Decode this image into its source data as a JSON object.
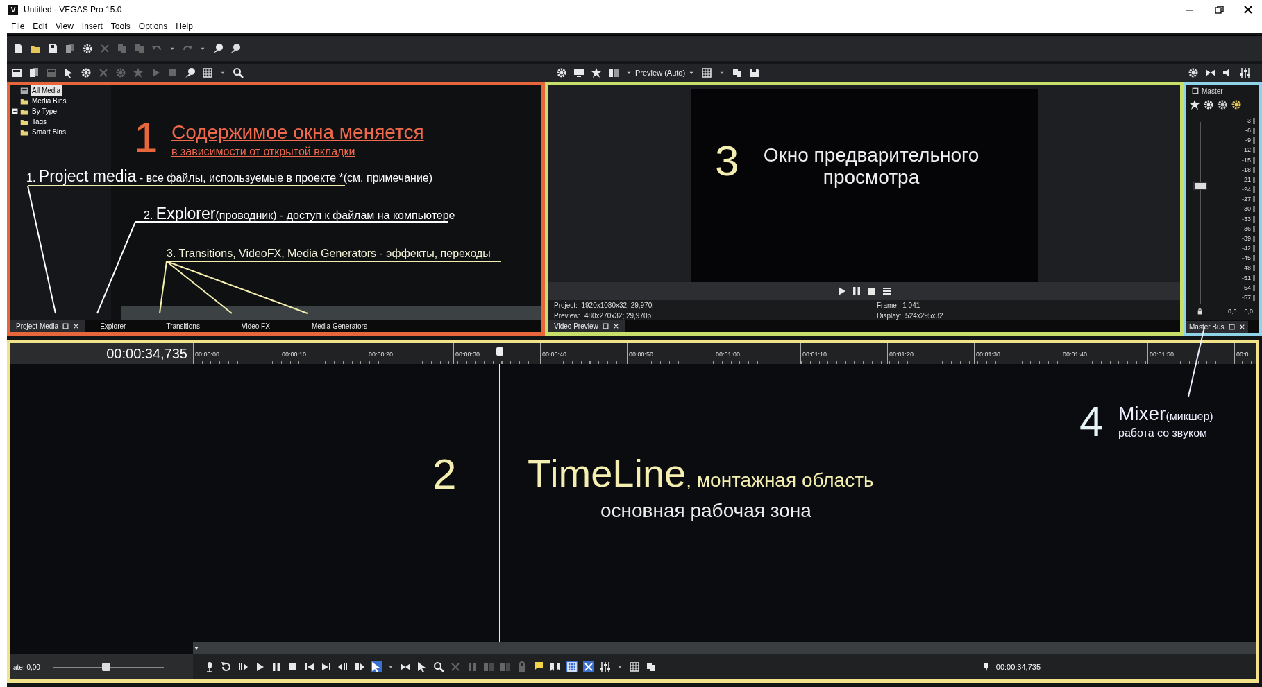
{
  "window": {
    "logo": "V",
    "title": "Untitled - VEGAS Pro 15.0"
  },
  "menu": [
    "File",
    "Edit",
    "View",
    "Insert",
    "Tools",
    "Options",
    "Help"
  ],
  "media_panel": {
    "tree": [
      {
        "label": "All Media",
        "selected": true
      },
      {
        "label": "Media Bins",
        "selected": false
      },
      {
        "label": "By Type",
        "selected": false,
        "expanded": true
      },
      {
        "label": "Tags",
        "selected": false
      },
      {
        "label": "Smart Bins",
        "selected": false
      }
    ],
    "annotation": {
      "number": "1",
      "title": "Содержимое окна меняется",
      "subtitle": "в зависимости от открытой вкладки"
    },
    "notes": [
      {
        "number": "1.",
        "term": "Project media",
        "text": " - все файлы, используемые в проекте *(см. примечание)"
      },
      {
        "number": "2.",
        "term": "Explorer",
        "text": "(проводник) - доступ к файлам на компьютере"
      },
      {
        "number": "3.",
        "text": "Transitions, VideoFX, Media Generators - эффекты, переходы"
      }
    ],
    "tabs": [
      {
        "label": "Project Media",
        "selected": true
      },
      {
        "label": "Explorer",
        "selected": false
      },
      {
        "label": "Transitions",
        "selected": false
      },
      {
        "label": "Video FX",
        "selected": false
      },
      {
        "label": "Media Generators",
        "selected": false
      }
    ]
  },
  "preview_panel": {
    "mode": "Preview (Auto)",
    "annotation": {
      "number": "3",
      "text": "Окно предварительного просмотра"
    },
    "info": [
      {
        "label": "Project:",
        "value": "1920x1080x32; 29,970i"
      },
      {
        "label": "Preview:",
        "value": "480x270x32; 29,970p"
      },
      {
        "label": "Frame:",
        "value": "1 041"
      },
      {
        "label": "Display:",
        "value": "524x295x32"
      }
    ],
    "tab": "Video Preview"
  },
  "mixer": {
    "channel": "Master",
    "fader": {
      "level": 0.65
    },
    "scale": [
      "-3",
      "-6",
      "-9",
      "-12",
      "-15",
      "-18",
      "-21",
      "-24",
      "-27",
      "-30",
      "-33",
      "-36",
      "-39",
      "-42",
      "-45",
      "-48",
      "-51",
      "-54",
      "-57"
    ],
    "readings": [
      "0,0",
      "0,0"
    ],
    "tab": "Master Bus"
  },
  "timeline": {
    "time": "00:00:34,735",
    "ruler": [
      "00:00:00",
      "00:00:10",
      "00:00:20",
      "00:00:30",
      "00:00:40",
      "00:00:50",
      "00:01:00",
      "00:01:10",
      "00:01:20",
      "00:01:30",
      "00:01:40",
      "00:01:50",
      "00:0"
    ],
    "playhead": {
      "level": 0.289
    },
    "annotation": {
      "number": "2",
      "term": "TimeLine",
      "text": ", монтажная область",
      "subtitle": "основная рабочая зона"
    },
    "mixer_annotation": {
      "number": "4",
      "term": "Mixer",
      "text": "(микшер)",
      "subtitle": "работа со звуком"
    },
    "rate": {
      "label": "ate: 0,00",
      "level": 0.48
    },
    "cursor_time": "00:00:34,735"
  }
}
